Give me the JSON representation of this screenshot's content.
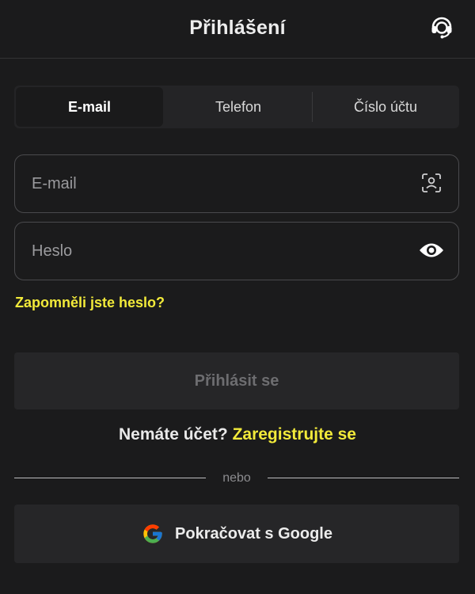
{
  "header": {
    "title": "Přihlášení",
    "support_icon": "headset-icon"
  },
  "tabs": [
    {
      "label": "E-mail",
      "active": true
    },
    {
      "label": "Telefon",
      "active": false
    },
    {
      "label": "Číslo účtu",
      "active": false
    }
  ],
  "form": {
    "email_placeholder": "E-mail",
    "email_value": "",
    "email_icon": "face-scan-icon",
    "password_placeholder": "Heslo",
    "password_value": "",
    "password_icon": "eye-icon",
    "forgot_label": "Zapomněli jste heslo?",
    "login_label": "Přihlásit se"
  },
  "register": {
    "prompt": "Nemáte účet?",
    "link": "Zaregistrujte se"
  },
  "divider_label": "nebo",
  "google": {
    "label": "Pokračovat s Google",
    "icon": "google-logo-icon"
  },
  "colors": {
    "background": "#1b1b1c",
    "accent": "#f2ea3a",
    "surface": "#262628"
  }
}
